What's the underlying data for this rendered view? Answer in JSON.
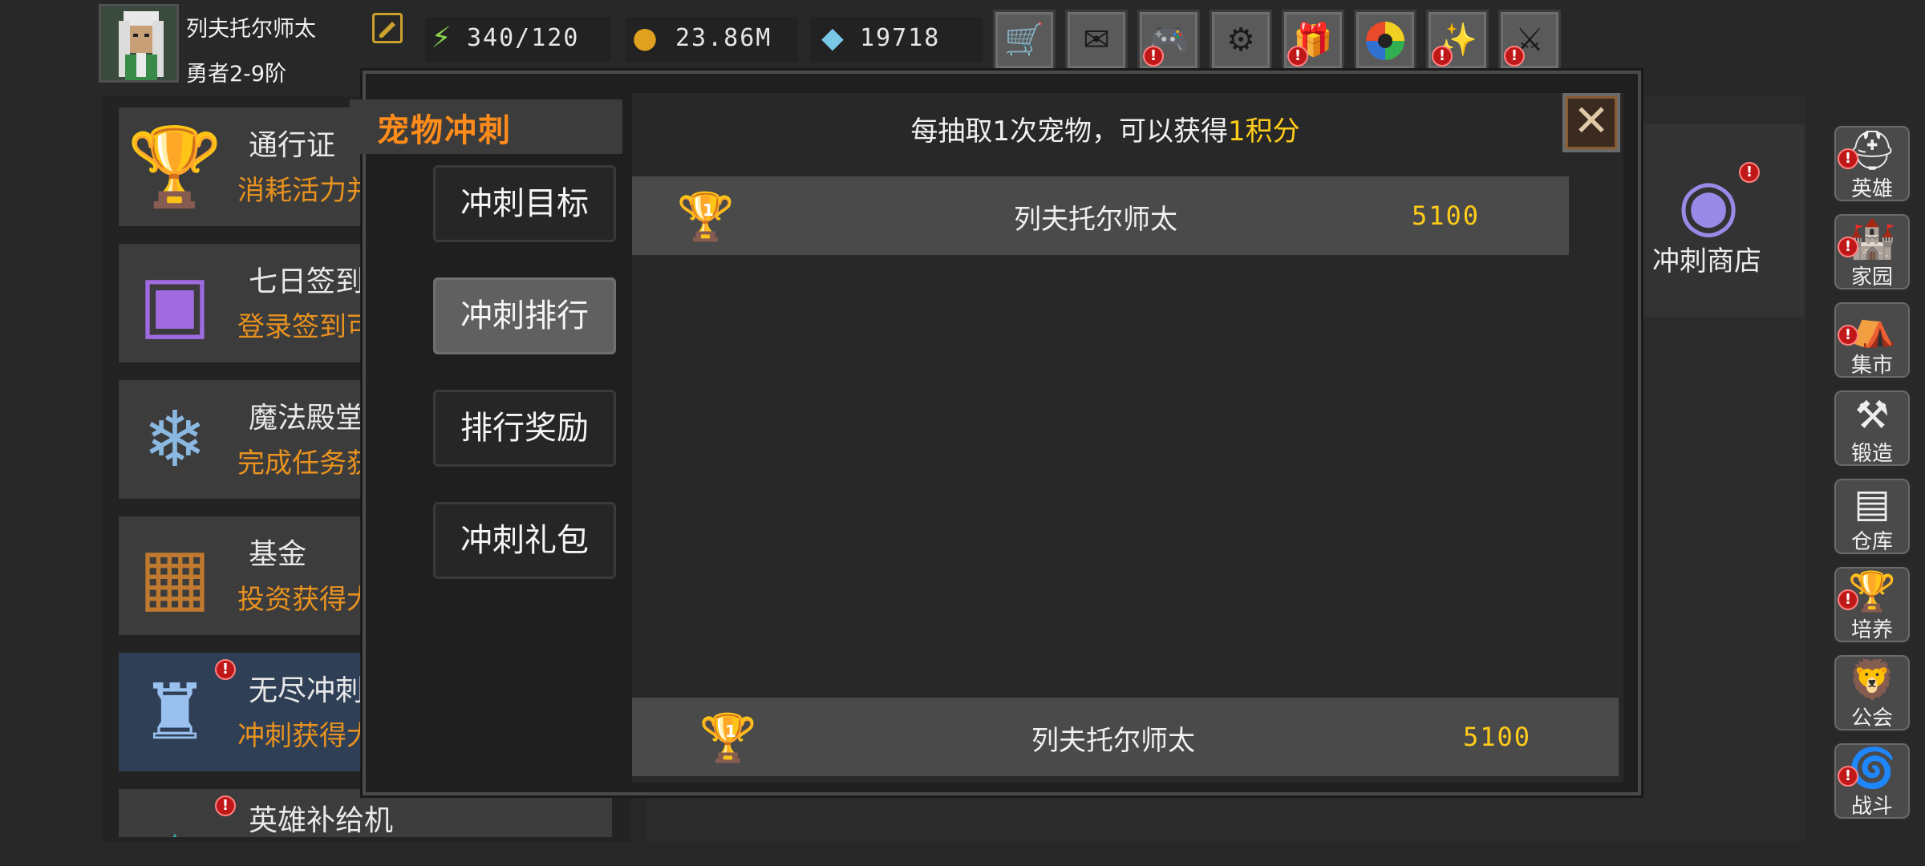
{
  "player": {
    "name": "列夫托尔师太",
    "rank": "勇者2-9阶",
    "avatar_icon": "hero-portrait-icon"
  },
  "resources": [
    {
      "icon": "energy-icon",
      "value": "340/120"
    },
    {
      "icon": "gold-coin-icon",
      "value": "23.86M"
    },
    {
      "icon": "diamond-icon",
      "value": "19718"
    }
  ],
  "top_buttons": [
    {
      "icon": "cart-icon",
      "badge": false
    },
    {
      "icon": "mail-icon",
      "badge": false
    },
    {
      "icon": "gamepad-icon",
      "badge": true
    },
    {
      "icon": "gear-icon",
      "badge": false
    },
    {
      "icon": "gift-icon",
      "badge": true
    },
    {
      "icon": "color-wheel-icon",
      "badge": false
    },
    {
      "icon": "firework-icon",
      "badge": true
    },
    {
      "icon": "sword-icon",
      "badge": true
    }
  ],
  "events": [
    {
      "title": "通行证",
      "subtitle": "消耗活力并",
      "icon": "golden-chalice-icon"
    },
    {
      "title": "七日签到",
      "subtitle": "登录签到可",
      "icon": "treasure-chest-icon"
    },
    {
      "title": "魔法殿堂",
      "subtitle": "完成任务获",
      "icon": "ice-crystal-icon"
    },
    {
      "title": "基金",
      "subtitle": "投资获得大",
      "icon": "money-chest-icon"
    },
    {
      "title": "无尽冲刺",
      "subtitle": "冲刺获得大",
      "icon": "crystal-armor-icon"
    },
    {
      "title": "英雄补给机",
      "subtitle": "",
      "icon": "supply-machine-icon"
    }
  ],
  "shop": {
    "label": "冲刺商店",
    "icon": "magic-orb-icon"
  },
  "sidebar": [
    {
      "label": "英雄",
      "icon": "helmet-icon",
      "badge": true
    },
    {
      "label": "家园",
      "icon": "castle-icon",
      "badge": true
    },
    {
      "label": "集市",
      "icon": "market-icon",
      "badge": true
    },
    {
      "label": "锻造",
      "icon": "anvil-icon",
      "badge": false
    },
    {
      "label": "仓库",
      "icon": "warehouse-icon",
      "badge": false
    },
    {
      "label": "培养",
      "icon": "trophy-cup-icon",
      "badge": true
    },
    {
      "label": "公会",
      "icon": "guild-icon",
      "badge": false
    },
    {
      "label": "战斗",
      "icon": "battle-portal-icon",
      "badge": true
    }
  ],
  "modal": {
    "title": "宠物冲刺",
    "nav": [
      {
        "label": "冲刺目标",
        "active": false
      },
      {
        "label": "冲刺排行",
        "active": true
      },
      {
        "label": "排行奖励",
        "active": false
      },
      {
        "label": "冲刺礼包",
        "active": false
      }
    ],
    "info_prefix": "每抽取1次宠物，可以获得",
    "info_highlight": "1积分",
    "close_icon": "close-x-icon",
    "rows": [
      {
        "rank": "1",
        "name": "列夫托尔师太",
        "score": "5100"
      }
    ],
    "self_row": {
      "rank": "1",
      "name": "列夫托尔师太",
      "score": "5100"
    }
  },
  "colors": {
    "accent_orange": "#ff8c1a",
    "score_yellow": "#ffcc1a",
    "badge_red": "#c01818"
  }
}
